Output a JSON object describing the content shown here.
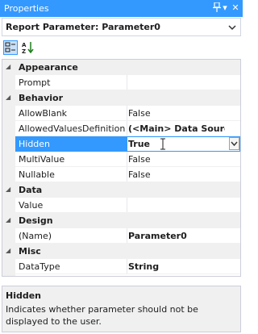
{
  "window": {
    "title": "Properties"
  },
  "selector": {
    "value": "Report Parameter: Parameter0"
  },
  "grid": {
    "categories": [
      {
        "name": "Appearance",
        "properties": [
          {
            "name": "Prompt",
            "value": "",
            "bold": false
          }
        ]
      },
      {
        "name": "Behavior",
        "properties": [
          {
            "name": "AllowBlank",
            "value": "False",
            "bold": false
          },
          {
            "name": "AllowedValuesDefinition",
            "value": "(<Main> Data Source)",
            "bold": true
          },
          {
            "name": "Hidden",
            "value": "True",
            "bold": true,
            "selected": true
          },
          {
            "name": "MultiValue",
            "value": "False",
            "bold": false
          },
          {
            "name": "Nullable",
            "value": "False",
            "bold": false
          }
        ]
      },
      {
        "name": "Data",
        "properties": [
          {
            "name": "Value",
            "value": "",
            "bold": false
          }
        ]
      },
      {
        "name": "Design",
        "properties": [
          {
            "name": "(Name)",
            "value": "Parameter0",
            "bold": true
          }
        ]
      },
      {
        "name": "Misc",
        "properties": [
          {
            "name": "DataType",
            "value": "String",
            "bold": true
          }
        ]
      }
    ]
  },
  "description": {
    "title": "Hidden",
    "text": "Indicates whether parameter should not be displayed to the user."
  },
  "colors": {
    "accent": "#3399ff",
    "panel": "#f0f0f0"
  },
  "icons": [
    "pin-icon",
    "dropdown-icon",
    "close-icon",
    "categorized-icon",
    "alphabetical-icon",
    "expanded-icon",
    "ibeam-cursor-icon"
  ]
}
